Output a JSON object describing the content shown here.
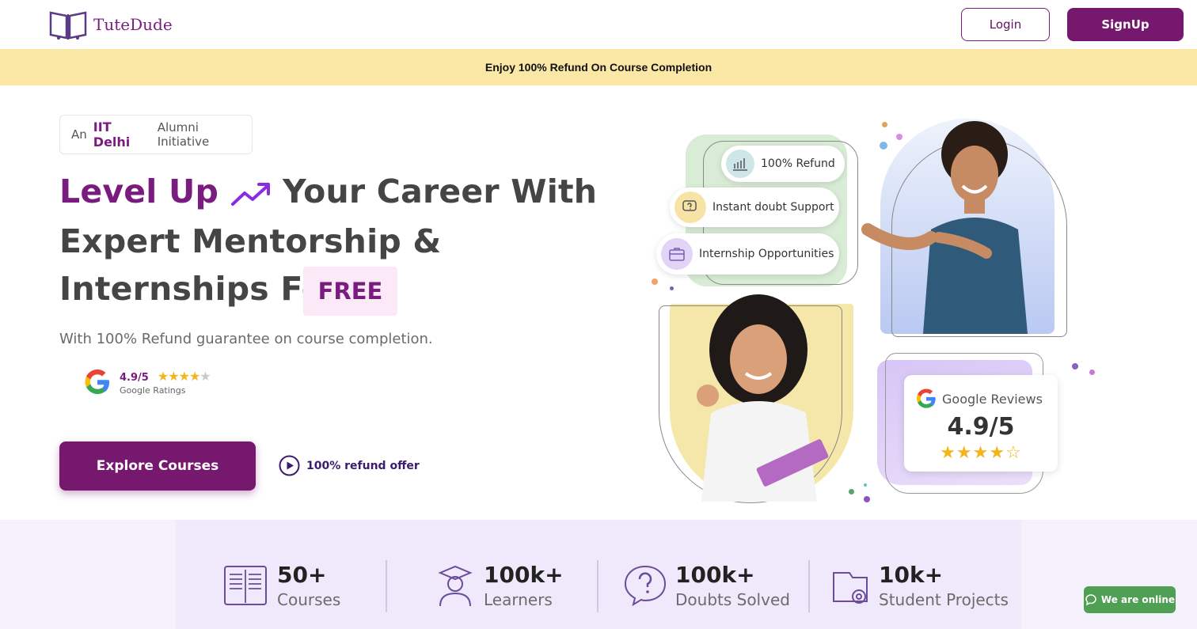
{
  "header": {
    "logo_text": "TuteDude",
    "login_label": "Login",
    "signup_label": "SignUp"
  },
  "banner": {
    "text": "Enjoy 100% Refund On Course Completion"
  },
  "hero": {
    "badge": {
      "prefix": "An",
      "highlight": "IIT Delhi",
      "suffix": "Alumni Initiative"
    },
    "headline": {
      "line1_accent": "Level Up",
      "line1_rest": "Your Career With",
      "line2": "Expert Mentorship &",
      "line3": "Internships For",
      "free": "FREE"
    },
    "subtext": "With 100% Refund guarantee on course completion.",
    "google_rating": {
      "score": "4.9/5",
      "label": "Google Ratings",
      "stars": 4.5
    },
    "explore_label": "Explore Courses",
    "refund_link": "100% refund offer"
  },
  "features": [
    {
      "label": "100% Refund",
      "icon": "chart-icon"
    },
    {
      "label": "Instant doubt Support",
      "icon": "question-chat-icon"
    },
    {
      "label": "Internship Opportunities",
      "icon": "briefcase-icon"
    }
  ],
  "review_card": {
    "title": "Google Reviews",
    "score": "4.9/5",
    "stars": 4
  },
  "stats": [
    {
      "number": "50+",
      "label": "Courses",
      "icon": "book-icon"
    },
    {
      "number": "100k+",
      "label": "Learners",
      "icon": "graduate-icon"
    },
    {
      "number": "100k+",
      "label": "Doubts Solved",
      "icon": "question-bubble-icon"
    },
    {
      "number": "10k+",
      "label": "Student Projects",
      "icon": "project-gear-icon"
    }
  ],
  "chat": {
    "label": "We are online"
  },
  "colors": {
    "brand": "#77186f",
    "banner": "#fbe8a7",
    "chat": "#4f9f55"
  }
}
